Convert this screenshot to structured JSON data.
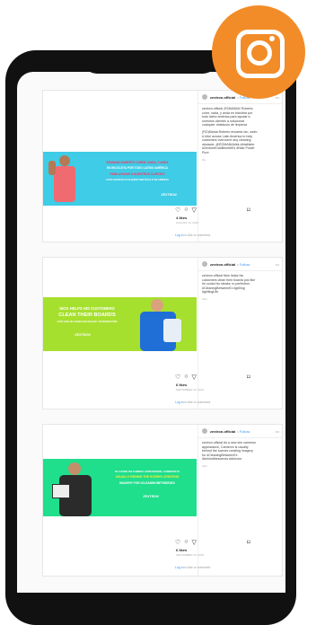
{
  "account": "zextron.official",
  "follow": "• Follow",
  "posts": [
    {
      "caption_lines": [
        "zextron.official ¡ROMANIA! Roberto",
        "corre, nada, y anda en bicicleta por",
        "todo latino américa para ayudar a",
        "nuestros clientes a solucionar",
        "cualquier obstáculo de limpieza",
        "",
        "(RO)Mania Roberto encanta ran, swim",
        "& bike across Latin America to help",
        "customers overcome any cleaning",
        "obstacle. @ROMANIA#bk #triathlete",
        "#ZextronEnAlBeneteEs #Nike Power",
        "Pure"
      ],
      "time": "2w",
      "likes": "4 likes",
      "date": "AUGUST 13, 2019",
      "login": "Log in",
      "login_rest": " to like or comment.",
      "img_text": [
        "ROMANIA ROBERTO CORRE, NADA, Y ANDA",
        "EN BICICLETA POR TODO LATINO AMÉRICA",
        "PARA AYUDAR A NUESTROS CLIENTES",
        "A SOLUCIONAR CUALQUIER OBSTÁCULO DE LIMPIEZA"
      ],
      "brand": "ZEXTRON"
    },
    {
      "caption_lines": [
        "zextron.official Nick helps his",
        "customers clean their boards just like",
        "he cooks his steaks: to perfection.",
        "#CleaningBetweenEx #grilling",
        "#grillingLife"
      ],
      "time": "16w",
      "likes": "6 likes",
      "date": "SEPTEMBER 19, 2019",
      "login": "Log in",
      "login_rest": " to like or comment.",
      "img_text": [
        "NICK HELPS HIS CUSTOMERS",
        "CLEAN THEIR BOARDS",
        "JUST LIKE HE COOKS HIS STEAKS: TO PERFECTION"
      ],
      "brand": "ZEXTRON"
    },
    {
      "caption_lines": [
        "zextron.official As a new sim cameron",
        "appearance, Cameron is usually",
        "behind the scenes creating imagery",
        "for #CleaningBetweenEx",
        "#behindthescenes #director"
      ],
      "time": "16w",
      "likes": "6 likes",
      "date": "SEPTEMBER 10, 2019",
      "login": "Log in",
      "login_rest": " to like or comment.",
      "img_text": [
        "IN A RARE ON CAMERA APPEARANCE, CAMERON IS",
        "USUALLY BEHIND THE SCENES CREATING",
        "IMAGERY FOR #CLEANINGBETWEENEX"
      ],
      "brand": "ZEXTRON"
    }
  ],
  "colors": {
    "ig": "#f28c28",
    "p1": "#3ecce6",
    "p2": "#a6e02e",
    "p3": "#1fde8c"
  }
}
